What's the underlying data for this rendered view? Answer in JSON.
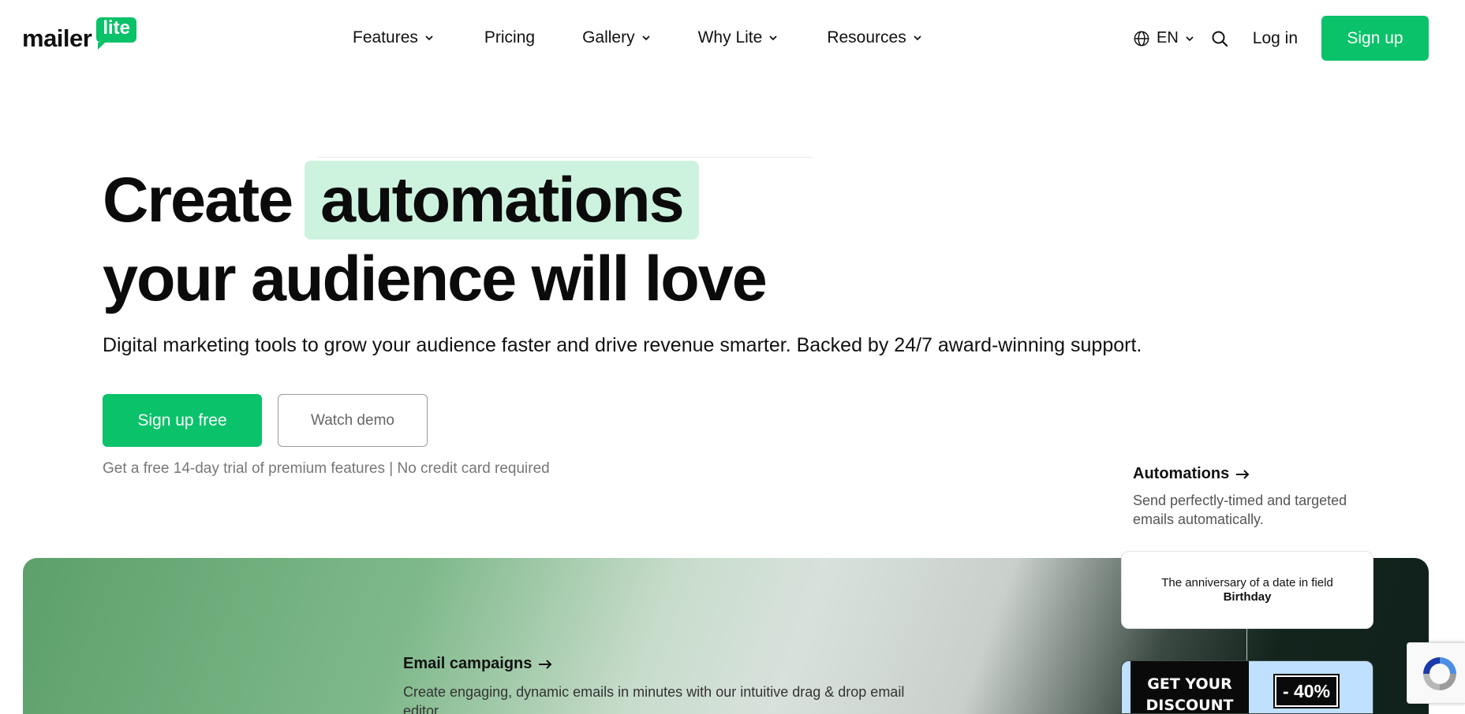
{
  "nav": {
    "logo": {
      "word": "mailer",
      "badge": "lite"
    },
    "menu": [
      {
        "label": "Features",
        "has_dropdown": true
      },
      {
        "label": "Pricing",
        "has_dropdown": false
      },
      {
        "label": "Gallery",
        "has_dropdown": true
      },
      {
        "label": "Why Lite",
        "has_dropdown": true
      },
      {
        "label": "Resources",
        "has_dropdown": true
      }
    ],
    "language": "EN",
    "login_label": "Log in",
    "signup_label": "Sign up"
  },
  "hero": {
    "title_prefix": "Create",
    "title_highlight": "automations",
    "title_line2": "your audience will love",
    "subtitle": "Digital marketing tools to grow your audience faster and drive revenue smarter. Backed by 24/7 award-winning support.",
    "primary_cta": "Sign up free",
    "secondary_cta": "Watch demo",
    "note": "Get a free 14-day trial of premium features | No credit card required"
  },
  "features": {
    "email_campaigns": {
      "title": "Email campaigns",
      "description": "Create engaging, dynamic emails in minutes with our intuitive drag & drop email editor."
    },
    "automations": {
      "title": "Automations",
      "description": "Send perfectly-timed and targeted emails automatically."
    }
  },
  "automation_card": {
    "text_prefix": "The anniversary of a date in field",
    "text_bold": "Birthday"
  },
  "promo_card": {
    "line1": "GET YOUR",
    "line2": "DISCOUNT",
    "badge": "- 40%"
  },
  "colors": {
    "brand_green": "#09c269",
    "highlight": "#cdf3df"
  }
}
